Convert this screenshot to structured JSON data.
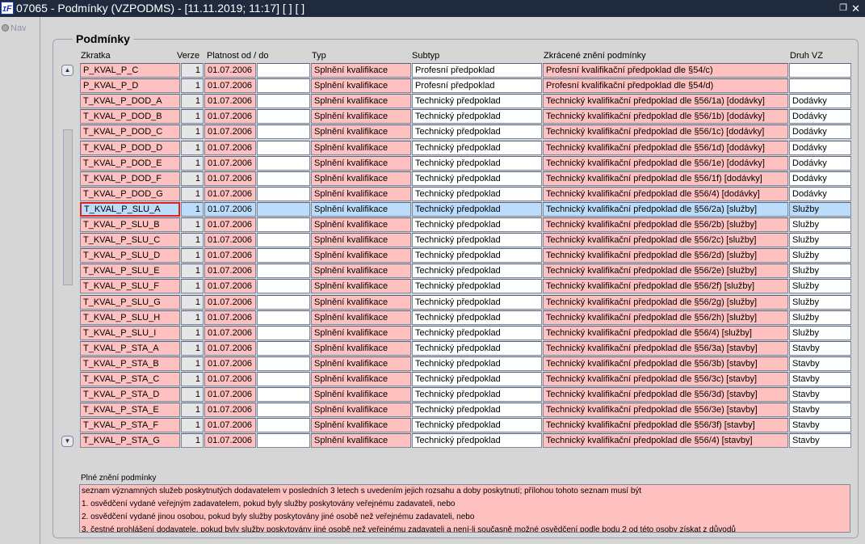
{
  "window": {
    "title": "07065 - Podmínky (VZPODMS) - [11.11.2019; 11:17]  [ ]  [ ]",
    "logo": "IF",
    "restore_icon": "restore-icon",
    "close_icon": "close-icon"
  },
  "nav": {
    "label": "Nav"
  },
  "section": {
    "title": "Podmínky"
  },
  "columns": {
    "zkratka": "Zkratka",
    "verze": "Verze",
    "platnost": "Platnost od / do",
    "typ": "Typ",
    "subtyp": "Subtyp",
    "zkracene": "Zkrácené znění podmínky",
    "druh": "Druh VZ"
  },
  "selected_row": 9,
  "rows": [
    {
      "zkratka": "P_KVAL_P_C",
      "verze": "1",
      "od": "01.07.2006",
      "do": "",
      "typ": "Splnění kvalifikace",
      "subtyp": "Profesní předpoklad",
      "zkracene": "Profesní kvalifikační předpoklad dle §54/c)",
      "druh": ""
    },
    {
      "zkratka": "P_KVAL_P_D",
      "verze": "1",
      "od": "01.07.2006",
      "do": "",
      "typ": "Splnění kvalifikace",
      "subtyp": "Profesní předpoklad",
      "zkracene": "Profesní kvalifikační předpoklad dle §54/d)",
      "druh": ""
    },
    {
      "zkratka": "T_KVAL_P_DOD_A",
      "verze": "1",
      "od": "01.07.2006",
      "do": "",
      "typ": "Splnění kvalifikace",
      "subtyp": "Technický předpoklad",
      "zkracene": "Technický kvalifikační předpoklad dle §56/1a) [dodávky]",
      "druh": "Dodávky"
    },
    {
      "zkratka": "T_KVAL_P_DOD_B",
      "verze": "1",
      "od": "01.07.2006",
      "do": "",
      "typ": "Splnění kvalifikace",
      "subtyp": "Technický předpoklad",
      "zkracene": "Technický kvalifikační předpoklad dle §56/1b) [dodávky]",
      "druh": "Dodávky"
    },
    {
      "zkratka": "T_KVAL_P_DOD_C",
      "verze": "1",
      "od": "01.07.2006",
      "do": "",
      "typ": "Splnění kvalifikace",
      "subtyp": "Technický předpoklad",
      "zkracene": "Technický kvalifikační předpoklad dle §56/1c) [dodávky]",
      "druh": "Dodávky"
    },
    {
      "zkratka": "T_KVAL_P_DOD_D",
      "verze": "1",
      "od": "01.07.2006",
      "do": "",
      "typ": "Splnění kvalifikace",
      "subtyp": "Technický předpoklad",
      "zkracene": "Technický kvalifikační předpoklad dle §56/1d) [dodávky]",
      "druh": "Dodávky"
    },
    {
      "zkratka": "T_KVAL_P_DOD_E",
      "verze": "1",
      "od": "01.07.2006",
      "do": "",
      "typ": "Splnění kvalifikace",
      "subtyp": "Technický předpoklad",
      "zkracene": "Technický kvalifikační předpoklad dle §56/1e) [dodávky]",
      "druh": "Dodávky"
    },
    {
      "zkratka": "T_KVAL_P_DOD_F",
      "verze": "1",
      "od": "01.07.2006",
      "do": "",
      "typ": "Splnění kvalifikace",
      "subtyp": "Technický předpoklad",
      "zkracene": "Technický kvalifikační předpoklad dle §56/1f) [dodávky]",
      "druh": "Dodávky"
    },
    {
      "zkratka": "T_KVAL_P_DOD_G",
      "verze": "1",
      "od": "01.07.2006",
      "do": "",
      "typ": "Splnění kvalifikace",
      "subtyp": "Technický předpoklad",
      "zkracene": "Technický kvalifikační předpoklad dle §56/4) [dodávky]",
      "druh": "Dodávky"
    },
    {
      "zkratka": "T_KVAL_P_SLU_A",
      "verze": "1",
      "od": "01.07.2006",
      "do": "",
      "typ": "Splnění kvalifikace",
      "subtyp": "Technický předpoklad",
      "zkracene": "Technický kvalifikační předpoklad dle §56/2a) [služby]",
      "druh": "Služby"
    },
    {
      "zkratka": "T_KVAL_P_SLU_B",
      "verze": "1",
      "od": "01.07.2006",
      "do": "",
      "typ": "Splnění kvalifikace",
      "subtyp": "Technický předpoklad",
      "zkracene": "Technický kvalifikační předpoklad dle §56/2b) [služby]",
      "druh": "Služby"
    },
    {
      "zkratka": "T_KVAL_P_SLU_C",
      "verze": "1",
      "od": "01.07.2006",
      "do": "",
      "typ": "Splnění kvalifikace",
      "subtyp": "Technický předpoklad",
      "zkracene": "Technický kvalifikační předpoklad dle §56/2c) [služby]",
      "druh": "Služby"
    },
    {
      "zkratka": "T_KVAL_P_SLU_D",
      "verze": "1",
      "od": "01.07.2006",
      "do": "",
      "typ": "Splnění kvalifikace",
      "subtyp": "Technický předpoklad",
      "zkracene": "Technický kvalifikační předpoklad dle §56/2d) [služby]",
      "druh": "Služby"
    },
    {
      "zkratka": "T_KVAL_P_SLU_E",
      "verze": "1",
      "od": "01.07.2006",
      "do": "",
      "typ": "Splnění kvalifikace",
      "subtyp": "Technický předpoklad",
      "zkracene": "Technický kvalifikační předpoklad dle §56/2e) [služby]",
      "druh": "Služby"
    },
    {
      "zkratka": "T_KVAL_P_SLU_F",
      "verze": "1",
      "od": "01.07.2006",
      "do": "",
      "typ": "Splnění kvalifikace",
      "subtyp": "Technický předpoklad",
      "zkracene": "Technický kvalifikační předpoklad dle §56/2f) [služby]",
      "druh": "Služby"
    },
    {
      "zkratka": "T_KVAL_P_SLU_G",
      "verze": "1",
      "od": "01.07.2006",
      "do": "",
      "typ": "Splnění kvalifikace",
      "subtyp": "Technický předpoklad",
      "zkracene": "Technický kvalifikační předpoklad dle §56/2g) [služby]",
      "druh": "Služby"
    },
    {
      "zkratka": "T_KVAL_P_SLU_H",
      "verze": "1",
      "od": "01.07.2006",
      "do": "",
      "typ": "Splnění kvalifikace",
      "subtyp": "Technický předpoklad",
      "zkracene": "Technický kvalifikační předpoklad dle §56/2h) [služby]",
      "druh": "Služby"
    },
    {
      "zkratka": "T_KVAL_P_SLU_I",
      "verze": "1",
      "od": "01.07.2006",
      "do": "",
      "typ": "Splnění kvalifikace",
      "subtyp": "Technický předpoklad",
      "zkracene": "Technický kvalifikační předpoklad dle §56/4) [služby]",
      "druh": "Služby"
    },
    {
      "zkratka": "T_KVAL_P_STA_A",
      "verze": "1",
      "od": "01.07.2006",
      "do": "",
      "typ": "Splnění kvalifikace",
      "subtyp": "Technický předpoklad",
      "zkracene": "Technický kvalifikační předpoklad dle §56/3a) [stavby]",
      "druh": "Stavby"
    },
    {
      "zkratka": "T_KVAL_P_STA_B",
      "verze": "1",
      "od": "01.07.2006",
      "do": "",
      "typ": "Splnění kvalifikace",
      "subtyp": "Technický předpoklad",
      "zkracene": "Technický kvalifikační předpoklad dle §56/3b) [stavby]",
      "druh": "Stavby"
    },
    {
      "zkratka": "T_KVAL_P_STA_C",
      "verze": "1",
      "od": "01.07.2006",
      "do": "",
      "typ": "Splnění kvalifikace",
      "subtyp": "Technický předpoklad",
      "zkracene": "Technický kvalifikační předpoklad dle §56/3c) [stavby]",
      "druh": "Stavby"
    },
    {
      "zkratka": "T_KVAL_P_STA_D",
      "verze": "1",
      "od": "01.07.2006",
      "do": "",
      "typ": "Splnění kvalifikace",
      "subtyp": "Technický předpoklad",
      "zkracene": "Technický kvalifikační předpoklad dle §56/3d) [stavby]",
      "druh": "Stavby"
    },
    {
      "zkratka": "T_KVAL_P_STA_E",
      "verze": "1",
      "od": "01.07.2006",
      "do": "",
      "typ": "Splnění kvalifikace",
      "subtyp": "Technický předpoklad",
      "zkracene": "Technický kvalifikační předpoklad dle §56/3e) [stavby]",
      "druh": "Stavby"
    },
    {
      "zkratka": "T_KVAL_P_STA_F",
      "verze": "1",
      "od": "01.07.2006",
      "do": "",
      "typ": "Splnění kvalifikace",
      "subtyp": "Technický předpoklad",
      "zkracene": "Technický kvalifikační předpoklad dle §56/3f) [stavby]",
      "druh": "Stavby"
    },
    {
      "zkratka": "T_KVAL_P_STA_G",
      "verze": "1",
      "od": "01.07.2006",
      "do": "",
      "typ": "Splnění kvalifikace",
      "subtyp": "Technický předpoklad",
      "zkracene": "Technický kvalifikační předpoklad dle §56/4) [stavby]",
      "druh": "Stavby"
    }
  ],
  "full_text": {
    "label": "Plné znění podmínky",
    "lines": [
      "seznam významných služeb poskytnutých dodavatelem v posledních 3 letech s uvedením jejich rozsahu a doby poskytnutí; přílohou tohoto seznam musí být",
      "1. osvědčení vydané veřejným zadavatelem, pokud byly služby poskytovány veřejnému zadavateli, nebo",
      "2. osvědčení vydané jinou osobou, pokud byly služby poskytovány jiné osobě než veřejnému zadavateli, nebo",
      "3. čestné prohlášení dodavatele, pokud byly služby poskytovány jiné osobě než veřejnému zadavateli a není-li současně možné osvědčení podle bodu 2 od této osoby získat z důvodů"
    ]
  },
  "colors": {
    "required": "#ffc0c0",
    "selected": "#bcdcfb",
    "titlebar": "#1f2a3d"
  }
}
